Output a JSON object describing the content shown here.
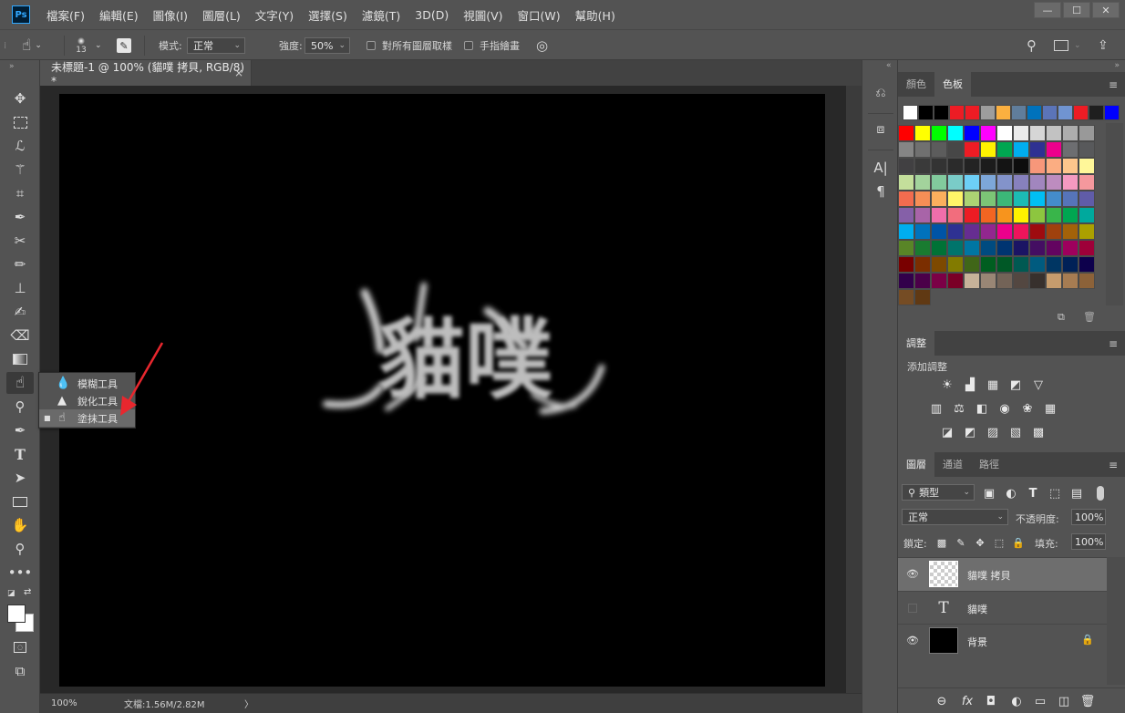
{
  "app": {
    "logo": "Ps"
  },
  "menu": [
    "檔案(F)",
    "編輯(E)",
    "圖像(I)",
    "圖層(L)",
    "文字(Y)",
    "選擇(S)",
    "濾鏡(T)",
    "3D(D)",
    "視圖(V)",
    "窗口(W)",
    "幫助(H)"
  ],
  "window_controls": {
    "minimize": "—",
    "maximize": "☐",
    "close": "✕"
  },
  "options": {
    "brush_size": "13",
    "mode_label": "模式:",
    "mode_value": "正常",
    "strength_label": "強度:",
    "strength_value": "50%",
    "sample_all_label": "對所有圖層取樣",
    "finger_paint_label": "手指繪畫"
  },
  "document": {
    "tab_title": "未標題-1 @ 100% (貓噗 拷貝, RGB/8) *",
    "close_glyph": "×",
    "canvas_text": "貓噗",
    "canvas_color": "#000000"
  },
  "flyout": {
    "items": [
      {
        "label": "模糊工具",
        "icon": "blur-tool-icon",
        "glyph": "💧",
        "selected": false
      },
      {
        "label": "銳化工具",
        "icon": "sharpen-tool-icon",
        "glyph": "▲",
        "selected": false
      },
      {
        "label": "塗抹工具",
        "icon": "smudge-tool-icon",
        "glyph": "☝",
        "selected": true
      }
    ],
    "selected_marker": "■"
  },
  "status": {
    "zoom": "100%",
    "doc_info": "文檔:1.56M/2.82M",
    "arrow": "〉"
  },
  "swatches_panel": {
    "tabs": [
      "顏色",
      "色板"
    ],
    "active_tab": "色板",
    "row0": [
      "#ffffff",
      "#000000",
      "#000000",
      "#ed1c24",
      "#ed1c24",
      "#9d9d9d",
      "#fbb040",
      "#607d9b",
      "#0072bc",
      "#5b74b8",
      "#7094d1",
      "#ed1c24",
      "#1f1f1f",
      "#0000ff"
    ],
    "grid": [
      [
        "#ff0000",
        "#ffff00",
        "#00ff00",
        "#00ffff",
        "#0000ff",
        "#ff00ff",
        "#ffffff",
        "#ebebeb",
        "#d6d6d6",
        "#c2c2c2",
        "#adadad",
        "#999999"
      ],
      [
        "#858585",
        "#707070",
        "#5c5c5c",
        "#474747",
        "#ed1c24",
        "#fff200",
        "#00a651",
        "#00aeef",
        "#2e3192",
        "#ec008c",
        "#6d6e71",
        "#58595b"
      ],
      [
        "#414042",
        "#3a3a3a",
        "#333333",
        "#2b2b2b",
        "#232323",
        "#1c1c1c",
        "#141414",
        "#0d0d0d",
        "#f7977a",
        "#fbad82",
        "#fdc68c",
        "#fff799"
      ],
      [
        "#c4df9b",
        "#a3d39c",
        "#82ca9d",
        "#7accc8",
        "#6dcff6",
        "#7da7d9",
        "#8393ca",
        "#8781bd",
        "#a186be",
        "#bd8cbf",
        "#f49ac1",
        "#f5989d"
      ],
      [
        "#f26c4f",
        "#f68e56",
        "#fbaf5d",
        "#fff568",
        "#acd373",
        "#7cc576",
        "#3cb878",
        "#1cbbb4",
        "#00bff3",
        "#448ccb",
        "#5674b9",
        "#605ca8"
      ],
      [
        "#8560a8",
        "#a864a8",
        "#f06eaa",
        "#f26d7d",
        "#ed1c24",
        "#f26522",
        "#f7941d",
        "#fff200",
        "#8dc63f",
        "#39b54a",
        "#00a651",
        "#00a99d"
      ],
      [
        "#00aeef",
        "#0072bc",
        "#0054a6",
        "#2e3192",
        "#662d91",
        "#92278f",
        "#ec008c",
        "#ed145b",
        "#9e0b0f",
        "#a0410d",
        "#a36209",
        "#aba000"
      ],
      [
        "#598527",
        "#197b30",
        "#007236",
        "#00746b",
        "#0076a3",
        "#004b80",
        "#003471",
        "#1b1464",
        "#440e62",
        "#630460",
        "#9e005d",
        "#9e0039"
      ],
      [
        "#790000",
        "#7b2e00",
        "#7d4900",
        "#827b00",
        "#406618",
        "#005e20",
        "#005826",
        "#005952",
        "#005b7f",
        "#003663",
        "#002157",
        "#0d004c"
      ],
      [
        "#32004b",
        "#4b0049",
        "#7b0046",
        "#7a0026",
        "#c7b299",
        "#998675",
        "#736357",
        "#534741",
        "#37302d",
        "#c69c6d",
        "#a67c52",
        "#8c6239"
      ],
      [
        "#754c24",
        "#603913"
      ]
    ]
  },
  "adjustments_panel": {
    "tab": "調整",
    "subtitle": "添加調整",
    "row1": [
      "☀",
      "▟",
      "▦",
      "◩",
      "▽"
    ],
    "row2": [
      "▥",
      "⚖",
      "◧",
      "◉",
      "❀",
      "▦"
    ],
    "row3": [
      "◪",
      "◩",
      "▨",
      "▧",
      "▩"
    ]
  },
  "layers_panel": {
    "tabs": [
      "圖層",
      "通道",
      "路徑"
    ],
    "active_tab": "圖層",
    "filter_label": "類型",
    "blend_mode": "正常",
    "opacity_label": "不透明度:",
    "opacity_value": "100%",
    "lock_label": "鎖定:",
    "fill_label": "填充:",
    "fill_value": "100%",
    "layers": [
      {
        "name": "貓噗 拷貝",
        "visible": true,
        "selected": true,
        "kind": "raster"
      },
      {
        "name": "貓噗",
        "visible": false,
        "selected": false,
        "kind": "text"
      },
      {
        "name": "背景",
        "visible": true,
        "selected": false,
        "kind": "background"
      }
    ],
    "bottom_icons": [
      "⊖",
      "fx",
      "◘",
      "◐",
      "▭",
      "◫",
      "🗑"
    ]
  }
}
